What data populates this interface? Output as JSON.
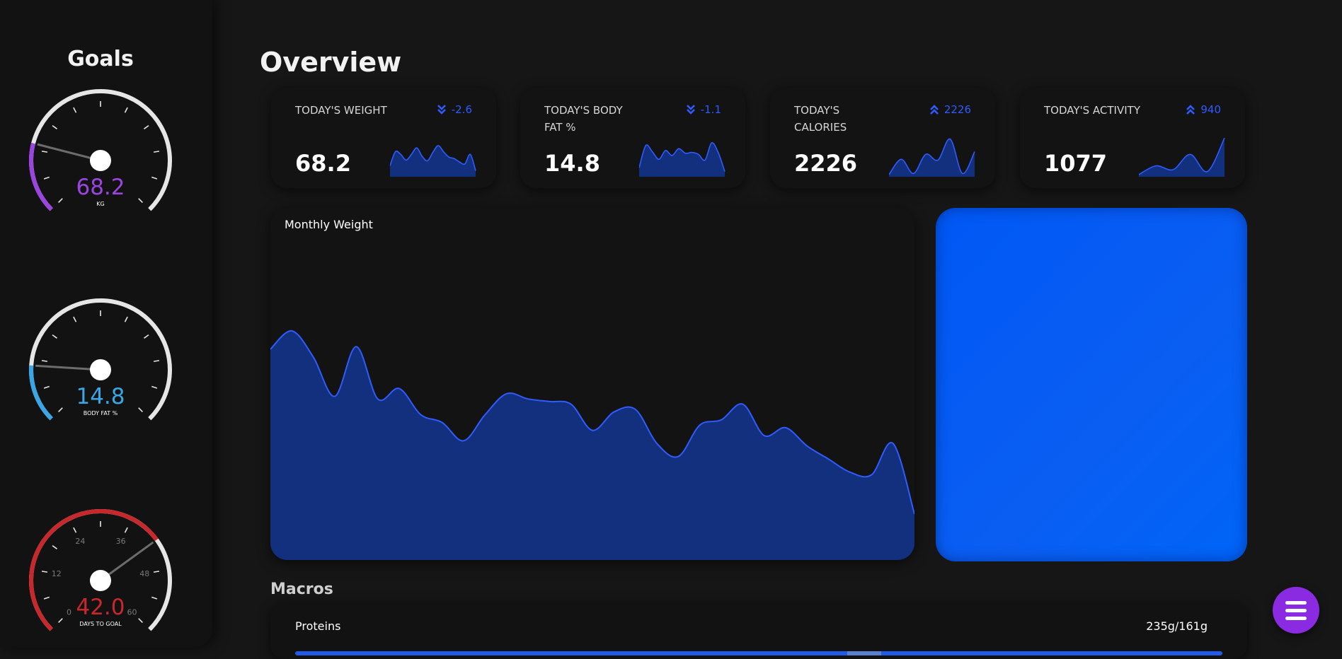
{
  "sidebar": {
    "title": "Goals",
    "gauges": [
      {
        "value": "68.2",
        "unit": "KG",
        "fraction": 0.22,
        "color": "#9b45e0"
      },
      {
        "value": "14.8",
        "unit": "BODY FAT %",
        "fraction": 0.18,
        "color": "#39a7e6"
      },
      {
        "value": "42.0",
        "unit": "DAYS TO GOAL",
        "fraction": 0.7,
        "color": "#c8282b",
        "ticks": [
          "0",
          "12",
          "24",
          "36",
          "48",
          "60"
        ]
      }
    ]
  },
  "overview": {
    "title": "Overview",
    "cards": [
      {
        "label": "TODAY'S WEIGHT",
        "value": "68.2",
        "delta": "-2.6",
        "direction": "down",
        "spark": [
          0.25,
          0.62,
          0.55,
          0.4,
          0.55,
          0.72,
          0.5,
          0.38,
          0.6,
          0.78,
          0.62,
          0.48,
          0.44,
          0.35,
          0.3,
          0.55,
          0.12
        ]
      },
      {
        "label": "TODAY'S BODY FAT %",
        "value": "14.8",
        "delta": "-1.1",
        "direction": "down",
        "spark": [
          0.2,
          0.78,
          0.62,
          0.42,
          0.65,
          0.52,
          0.7,
          0.58,
          0.6,
          0.55,
          0.4,
          0.85,
          0.6,
          0.1
        ]
      },
      {
        "label": "TODAY'S CALORIES",
        "value": "2226",
        "delta": "2226",
        "direction": "up",
        "spark": [
          0.02,
          0.42,
          0.05,
          0.55,
          0.4,
          0.95,
          0.05,
          0.62
        ]
      },
      {
        "label": "TODAY'S ACTIVITY",
        "value": "1077",
        "delta": "940",
        "direction": "up",
        "spark": [
          0.02,
          0.25,
          0.15,
          0.55,
          0.1,
          0.98
        ]
      }
    ]
  },
  "chart_data": {
    "type": "area",
    "title": "Monthly Weight",
    "values": [
      0.73,
      0.8,
      0.7,
      0.55,
      0.74,
      0.54,
      0.58,
      0.48,
      0.45,
      0.38,
      0.48,
      0.56,
      0.54,
      0.53,
      0.52,
      0.42,
      0.49,
      0.5,
      0.37,
      0.32,
      0.44,
      0.46,
      0.52,
      0.4,
      0.43,
      0.36,
      0.31,
      0.26,
      0.25,
      0.37,
      0.1
    ],
    "color": "#2f5bff",
    "fill": "#13307e"
  },
  "macros": {
    "title": "Macros",
    "items": [
      {
        "name": "Proteins",
        "amount": "235g/161g"
      }
    ]
  },
  "colors": {
    "accent": "#2f5bff",
    "panel": "#005af5",
    "fab": "#8a2be2"
  },
  "icons": {
    "fab": "hamburger-menu-icon",
    "down": "double-chevron-down-icon",
    "up": "double-chevron-up-icon"
  }
}
